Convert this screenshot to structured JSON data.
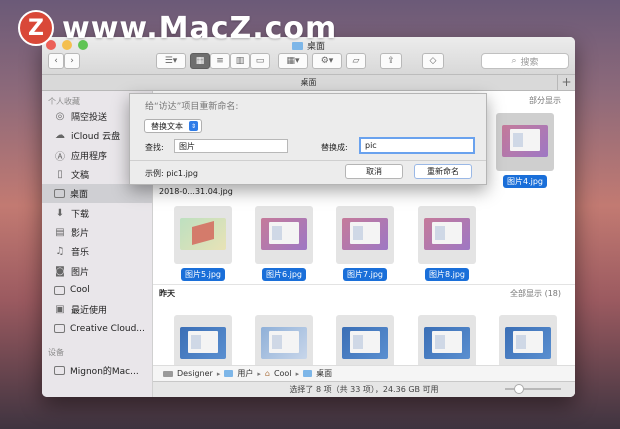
{
  "watermark": {
    "logo": "Z",
    "text": "www.MacZ.com"
  },
  "window": {
    "title": "桌面",
    "tab_label": "桌面",
    "search_placeholder": "搜索"
  },
  "sidebar": {
    "section_favorites": "个人收藏",
    "items": [
      {
        "label": "隔空投送",
        "icon": "airdrop-icon"
      },
      {
        "label": "iCloud 云盘",
        "icon": "cloud-icon"
      },
      {
        "label": "应用程序",
        "icon": "apps-icon"
      },
      {
        "label": "文稿",
        "icon": "document-icon"
      },
      {
        "label": "桌面",
        "icon": "desktop-icon",
        "selected": true
      },
      {
        "label": "下载",
        "icon": "download-icon"
      },
      {
        "label": "影片",
        "icon": "film-icon"
      },
      {
        "label": "音乐",
        "icon": "music-icon"
      },
      {
        "label": "图片",
        "icon": "camera-icon"
      },
      {
        "label": "Cool",
        "icon": "folder-icon"
      },
      {
        "label": "最近使用",
        "icon": "recent-icon"
      },
      {
        "label": "Creative Cloud...",
        "icon": "folder-icon"
      }
    ],
    "section_devices": "设备",
    "devices": [
      {
        "label": "Mignon的Mac...",
        "icon": "laptop-icon"
      }
    ]
  },
  "main": {
    "section1_show": "部分显示",
    "partial_file": "2018-0...31.04.jpg",
    "files": [
      {
        "name": "图片4.jpg"
      },
      {
        "name": "图片5.jpg"
      },
      {
        "name": "图片6.jpg"
      },
      {
        "name": "图片7.jpg"
      },
      {
        "name": "图片8.jpg"
      }
    ],
    "section2_title": "昨天",
    "section2_show": "全部显示 (18)"
  },
  "pathbar": {
    "items": [
      "Designer",
      "用户",
      "Cool",
      "桌面"
    ]
  },
  "status": {
    "text": "选择了 8 项（共 33 项），24.36 GB 可用",
    "zoom_fraction": 0.2
  },
  "dialog": {
    "title": "给“访达”项目重新命名:",
    "mode": "替换文本",
    "find_label": "查找:",
    "find_value": "图片",
    "replace_label": "替换成:",
    "replace_value": "pic",
    "example": "示例: pic1.jpg",
    "cancel": "取消",
    "rename": "重新命名"
  }
}
